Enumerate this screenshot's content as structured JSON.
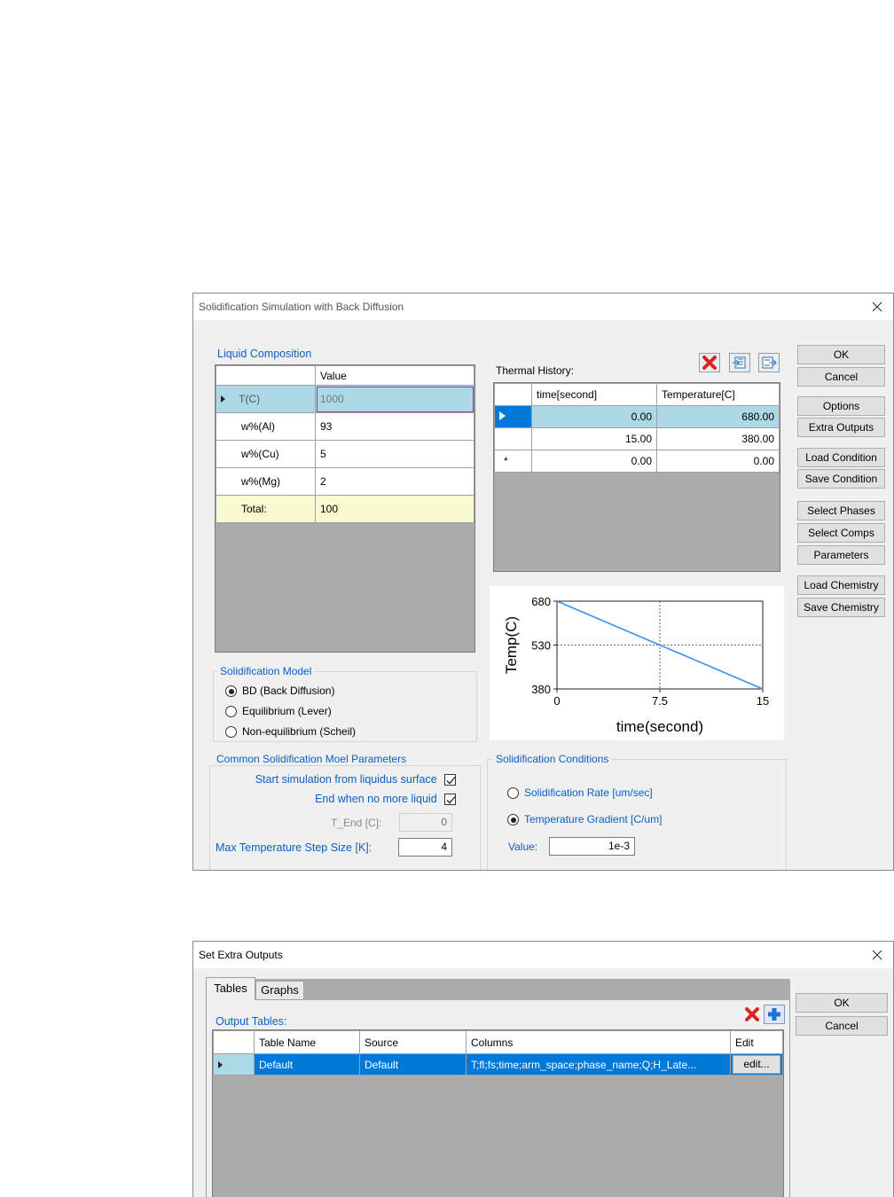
{
  "dialog1": {
    "title": "Solidification Simulation with Back Diffusion",
    "liquid_composition_label": "Liquid Composition",
    "comp_table": {
      "header": "Value",
      "rows": [
        {
          "name": "T(C)",
          "value": "1000"
        },
        {
          "name": "w%(Al)",
          "value": "93"
        },
        {
          "name": "w%(Cu)",
          "value": "5"
        },
        {
          "name": "w%(Mg)",
          "value": "2"
        },
        {
          "name": "Total:",
          "value": "100"
        }
      ]
    },
    "thermal_history_label": "Thermal History:",
    "thermal_table": {
      "headers": [
        "time[second]",
        "Temperature[C]"
      ],
      "rows": [
        {
          "time": "0.00",
          "temp": "680.00"
        },
        {
          "time": "15.00",
          "temp": "380.00"
        },
        {
          "time": "0.00",
          "temp": "0.00"
        }
      ],
      "new_row_marker": "*"
    },
    "buttons": {
      "ok": "OK",
      "cancel": "Cancel",
      "options": "Options",
      "extra_outputs": "Extra Outputs",
      "load_condition": "Load Condition",
      "save_condition": "Save Condition",
      "select_phases": "Select Phases",
      "select_comps": "Select Comps",
      "parameters": "Parameters",
      "load_chemistry": "Load Chemistry",
      "save_chemistry": "Save Chemistry"
    },
    "solid_model": {
      "label": "Solidification Model",
      "options": [
        "BD (Back Diffusion)",
        "Equilibrium (Lever)",
        "Non-equilibrium (Scheil)"
      ],
      "selected_index": 0
    },
    "common_params": {
      "label": "Common Solidification Moel Parameters",
      "start_liquidus": "Start simulation from liquidus surface",
      "end_no_liquid": "End when no more liquid",
      "t_end_label": "T_End [C]:",
      "t_end_value": "0",
      "max_step_label": "Max Temperature Step Size [K]:",
      "max_step_value": "4"
    },
    "conditions": {
      "label": "Solidification Conditions",
      "rate": "Solidification Rate [um/sec]",
      "gradient": "Temperature Gradient [C/um]",
      "value_label": "Value:",
      "value": "1e-3"
    }
  },
  "chart_data": {
    "type": "line",
    "x": [
      0,
      15
    ],
    "series": [
      {
        "values": [
          680,
          380
        ]
      }
    ],
    "xlabel": "time(second)",
    "ylabel": "Temp(C)",
    "xlim": [
      0,
      15
    ],
    "ylim": [
      380,
      680
    ],
    "xticks": [
      "0",
      "7.5",
      "15"
    ],
    "yticks": [
      "680",
      "530",
      "380"
    ],
    "grid": true,
    "line_color": "#3c8ff0"
  },
  "dialog2": {
    "title": "Set Extra Outputs",
    "tabs": [
      "Tables",
      "Graphs"
    ],
    "output_tables_label": "Output Tables:",
    "table": {
      "headers": [
        "Table Name",
        "Source",
        "Columns",
        "Edit"
      ],
      "rows": [
        {
          "name": "Default",
          "source": "Default",
          "columns": "T;fl;fs;time;arm_space;phase_name;Q;H_Late...",
          "edit": "edit..."
        }
      ]
    },
    "ok": "OK",
    "cancel": "Cancel"
  },
  "colors": {
    "selection": "#0078d7",
    "selected_row_light": "#add8e6",
    "total_row": "#fafad2"
  }
}
